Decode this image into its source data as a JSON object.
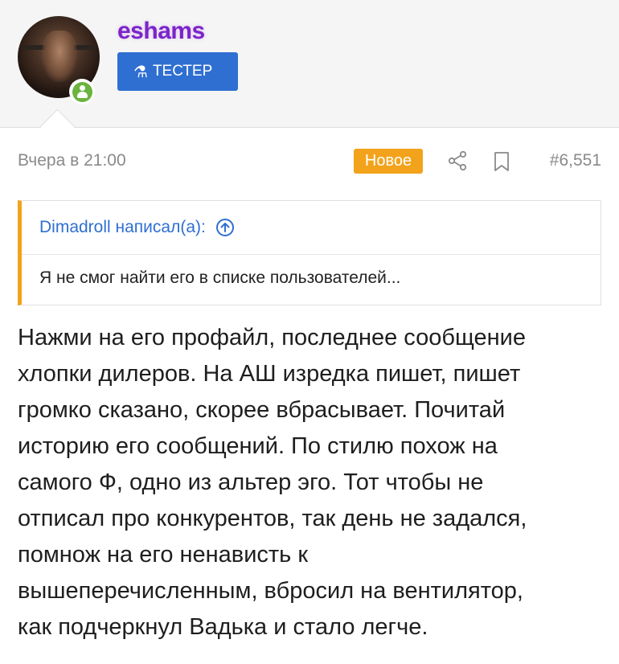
{
  "user": {
    "username": "eshams",
    "badge_label": "ТЕСТЕР",
    "badge_icon": "flask-icon",
    "online_icon": "online-user-icon",
    "colors": {
      "username": "#7a24c9",
      "badge_bg": "#2f6fd1",
      "online": "#6cb33f"
    }
  },
  "post": {
    "date": "Вчера в 21:00",
    "new_label": "Новое",
    "post_number": "#6,551",
    "share_icon": "share-icon",
    "bookmark_icon": "bookmark-icon",
    "colors": {
      "new_badge": "#f2a31b",
      "meta_text": "#8a8a8a"
    }
  },
  "quote": {
    "author_line": "Dimadroll написал(а):",
    "jump_icon": "arrow-up-circle-icon",
    "text": "Я не смог найти его в списке пользователей..."
  },
  "message": {
    "text": "Нажми на его профайл, последнее сообщение\nхлопки дилеров. На АШ изредка пишет, пишет\nгромко сказано, скорее вбрасывает. Почитай\nисторию его сообщений. По стилю похож на\nсамого Ф, одно из альтер эго. Тот чтобы не\nотписал про конкурентов, так день не задался,\nпомнож на его ненависть к\nвышеперечисленным, вбросил на вентилятор,\nкак подчеркнул Вадька и стало легче."
  }
}
